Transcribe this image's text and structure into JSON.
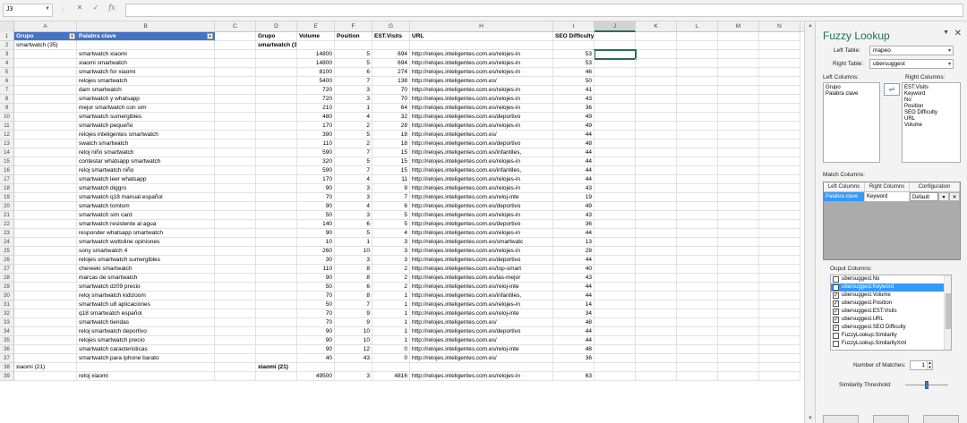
{
  "formula_bar": {
    "name_box": "J3",
    "fx_label": "fx",
    "formula": ""
  },
  "columns": [
    "A",
    "B",
    "C",
    "D",
    "E",
    "F",
    "G",
    "H",
    "I",
    "J",
    "K",
    "L",
    "M",
    "N"
  ],
  "selected_column": "J",
  "rows": [
    {
      "n": "1",
      "a": "Grupo",
      "b": "Palabra clave",
      "d": "Grupo",
      "e": "Volume",
      "f": "Position",
      "g": "EST.Visits",
      "h": "URL",
      "i": "SEO Difficulty"
    },
    {
      "n": "2",
      "a": "smartwatch (35)",
      "b": "",
      "d": "smartwatch (35)",
      "e": "",
      "f": "",
      "g": "",
      "h": "",
      "i": ""
    },
    {
      "n": "3",
      "a": "",
      "b": "smartwatch xiaomi",
      "d": "",
      "e": "14800",
      "f": "5",
      "g": "694",
      "h": "http://relojes.inteligentes.com.es/relojes-in",
      "i": "53"
    },
    {
      "n": "4",
      "a": "",
      "b": "xiaomi smartwatch",
      "d": "",
      "e": "14800",
      "f": "5",
      "g": "694",
      "h": "http://relojes.inteligentes.com.es/relojes-in",
      "i": "53"
    },
    {
      "n": "5",
      "a": "",
      "b": "smartwatch for xiaomi",
      "d": "",
      "e": "8100",
      "f": "6",
      "g": "274",
      "h": "http://relojes.inteligentes.com.es/relojes-in",
      "i": "46"
    },
    {
      "n": "6",
      "a": "",
      "b": "relojes smartwatch",
      "d": "",
      "e": "5400",
      "f": "7",
      "g": "138",
      "h": "http://relojes.inteligentes.com.es/",
      "i": "50"
    },
    {
      "n": "7",
      "a": "",
      "b": "dam smartwatch",
      "d": "",
      "e": "720",
      "f": "3",
      "g": "70",
      "h": "http://relojes.inteligentes.com.es/relojes-in",
      "i": "41"
    },
    {
      "n": "8",
      "a": "",
      "b": "smartwatch y whatsapp",
      "d": "",
      "e": "720",
      "f": "3",
      "g": "70",
      "h": "http://relojes.inteligentes.com.es/relojes-in",
      "i": "43"
    },
    {
      "n": "9",
      "a": "",
      "b": "mejor smartwatch con sim",
      "d": "",
      "e": "210",
      "f": "1",
      "g": "64",
      "h": "http://relojes.inteligentes.com.es/relojes-in",
      "i": "36"
    },
    {
      "n": "10",
      "a": "",
      "b": "smartwatch sumergibles",
      "d": "",
      "e": "480",
      "f": "4",
      "g": "32",
      "h": "http://relojes.inteligentes.com.es/deportivo",
      "i": "49"
    },
    {
      "n": "11",
      "a": "",
      "b": "smartwatch pequeño",
      "d": "",
      "e": "170",
      "f": "2",
      "g": "28",
      "h": "http://relojes.inteligentes.com.es/relojes-in",
      "i": "49"
    },
    {
      "n": "12",
      "a": "",
      "b": "relojes inteligentes smartwatch",
      "d": "",
      "e": "390",
      "f": "5",
      "g": "18",
      "h": "http://relojes.inteligentes.com.es/",
      "i": "44"
    },
    {
      "n": "13",
      "a": "",
      "b": "swatch smartwatch",
      "d": "",
      "e": "110",
      "f": "2",
      "g": "18",
      "h": "http://relojes.inteligentes.com.es/deportivo",
      "i": "48"
    },
    {
      "n": "14",
      "a": "",
      "b": "reloj niño smartwatch",
      "d": "",
      "e": "590",
      "f": "7",
      "g": "15",
      "h": "http://relojes.inteligentes.com.es/infantiles,",
      "i": "44"
    },
    {
      "n": "15",
      "a": "",
      "b": "contestar whatsapp smartwatch",
      "d": "",
      "e": "320",
      "f": "5",
      "g": "15",
      "h": "http://relojes.inteligentes.com.es/relojes-in",
      "i": "44"
    },
    {
      "n": "16",
      "a": "",
      "b": "reloj smartwatch niño",
      "d": "",
      "e": "590",
      "f": "7",
      "g": "15",
      "h": "http://relojes.inteligentes.com.es/infantiles,",
      "i": "44"
    },
    {
      "n": "17",
      "a": "",
      "b": "smartwatch leer whatsapp",
      "d": "",
      "e": "170",
      "f": "4",
      "g": "11",
      "h": "http://relojes.inteligentes.com.es/relojes-in",
      "i": "44"
    },
    {
      "n": "18",
      "a": "",
      "b": "smartwatch diggro",
      "d": "",
      "e": "90",
      "f": "3",
      "g": "9",
      "h": "http://relojes.inteligentes.com.es/relojes-in",
      "i": "43"
    },
    {
      "n": "19",
      "a": "",
      "b": "smartwatch q18 manual español",
      "d": "",
      "e": "70",
      "f": "3",
      "g": "7",
      "h": "http://relojes.inteligentes.com.es/reloj-inte",
      "i": "19"
    },
    {
      "n": "20",
      "a": "",
      "b": "smartwatch tomtom",
      "d": "",
      "e": "90",
      "f": "4",
      "g": "6",
      "h": "http://relojes.inteligentes.com.es/deportivo",
      "i": "49"
    },
    {
      "n": "21",
      "a": "",
      "b": "smartwatch sim card",
      "d": "",
      "e": "50",
      "f": "3",
      "g": "5",
      "h": "http://relojes.inteligentes.com.es/relojes-in",
      "i": "43"
    },
    {
      "n": "22",
      "a": "",
      "b": "smartwatch resistente al agua",
      "d": "",
      "e": "140",
      "f": "6",
      "g": "5",
      "h": "http://relojes.inteligentes.com.es/deportivo",
      "i": "36"
    },
    {
      "n": "23",
      "a": "",
      "b": "responder whatsapp smartwatch",
      "d": "",
      "e": "90",
      "f": "5",
      "g": "4",
      "h": "http://relojes.inteligentes.com.es/relojes-in",
      "i": "44"
    },
    {
      "n": "24",
      "a": "",
      "b": "smartwatch wottoline opiniones",
      "d": "",
      "e": "10",
      "f": "1",
      "g": "3",
      "h": "http://relojes.inteligentes.com.es/smartwatc",
      "i": "13"
    },
    {
      "n": "25",
      "a": "",
      "b": "sony smartwatch 4",
      "d": "",
      "e": "260",
      "f": "10",
      "g": "3",
      "h": "http://relojes.inteligentes.com.es/relojes-in",
      "i": "28"
    },
    {
      "n": "26",
      "a": "",
      "b": "relojes smartwatch sumergibles",
      "d": "",
      "e": "30",
      "f": "3",
      "g": "3",
      "h": "http://relojes.inteligentes.com.es/deportivo",
      "i": "44"
    },
    {
      "n": "27",
      "a": "",
      "b": "chereeki smartwatch",
      "d": "",
      "e": "110",
      "f": "8",
      "g": "2",
      "h": "http://relojes.inteligentes.com.es/top-smart",
      "i": "40"
    },
    {
      "n": "28",
      "a": "",
      "b": "marcas de smartwatch",
      "d": "",
      "e": "90",
      "f": "8",
      "g": "2",
      "h": "http://relojes.inteligentes.com.es/las-mejor",
      "i": "43"
    },
    {
      "n": "29",
      "a": "",
      "b": "smartwatch dz09 precio",
      "d": "",
      "e": "50",
      "f": "6",
      "g": "2",
      "h": "http://relojes.inteligentes.com.es/reloj-inte",
      "i": "44"
    },
    {
      "n": "30",
      "a": "",
      "b": "reloj smartwatch kidizoom",
      "d": "",
      "e": "70",
      "f": "8",
      "g": "1",
      "h": "http://relojes.inteligentes.com.es/infantiles,",
      "i": "44"
    },
    {
      "n": "31",
      "a": "",
      "b": "smartwatch u8 aplicaciones",
      "d": "",
      "e": "50",
      "f": "7",
      "g": "1",
      "h": "http://relojes.inteligentes.com.es/relojes-in",
      "i": "14"
    },
    {
      "n": "32",
      "a": "",
      "b": "q18 smartwatch español",
      "d": "",
      "e": "70",
      "f": "9",
      "g": "1",
      "h": "http://relojes.inteligentes.com.es/reloj-inte",
      "i": "34"
    },
    {
      "n": "33",
      "a": "",
      "b": "smartwatch tiendas",
      "d": "",
      "e": "70",
      "f": "9",
      "g": "1",
      "h": "http://relojes.inteligentes.com.es/",
      "i": "48"
    },
    {
      "n": "34",
      "a": "",
      "b": "reloj smartwatch deportivo",
      "d": "",
      "e": "90",
      "f": "10",
      "g": "1",
      "h": "http://relojes.inteligentes.com.es/deportivo",
      "i": "44"
    },
    {
      "n": "35",
      "a": "",
      "b": "relojes smartwatch precio",
      "d": "",
      "e": "90",
      "f": "10",
      "g": "1",
      "h": "http://relojes.inteligentes.com.es/",
      "i": "44"
    },
    {
      "n": "36",
      "a": "",
      "b": "smartwatch caracteristicas",
      "d": "",
      "e": "90",
      "f": "12",
      "g": "0",
      "h": "http://relojes.inteligentes.com.es/reloj-inte",
      "i": "48"
    },
    {
      "n": "37",
      "a": "",
      "b": "smartwatch para iphone barato",
      "d": "",
      "e": "40",
      "f": "43",
      "g": "0",
      "h": "http://relojes.inteligentes.com.es/",
      "i": "36"
    },
    {
      "n": "38",
      "a": "xiaomi (21)",
      "b": "",
      "d": "xiaomi (21)",
      "e": "",
      "f": "",
      "g": "",
      "h": "",
      "i": ""
    },
    {
      "n": "39",
      "a": "",
      "b": "reloj xiaomi",
      "d": "",
      "e": "49500",
      "f": "3",
      "g": "4816",
      "h": "http://relojes.inteligentes.com.es/relojes-in",
      "i": "63"
    }
  ],
  "panel": {
    "title": "Fuzzy Lookup",
    "left_table_label": "Left Table:",
    "left_table_value": "mapeo",
    "right_table_label": "Right Table:",
    "right_table_value": "ubersuggest",
    "left_columns_label": "Left Columns:",
    "right_columns_label": "Right Columns:",
    "left_columns": [
      "Grupo",
      "Palabra clave"
    ],
    "right_columns": [
      "EST.Visits",
      "Keyword",
      "No",
      "Position",
      "SEO Difficulty",
      "URL",
      "Volume"
    ],
    "match_columns_label": "Match Columns:",
    "match_headers": [
      "Left Columns",
      "Right Columns",
      "Configuration"
    ],
    "match_row": {
      "left": "Palabra clave",
      "right": "Keyword",
      "config": "Default"
    },
    "output_columns_label": "Ouput Columns:",
    "output_columns": [
      {
        "label": "ubersuggest.No",
        "checked": false,
        "selected": false
      },
      {
        "label": "ubersuggest.Keyword",
        "checked": false,
        "selected": true
      },
      {
        "label": "ubersuggest.Volume",
        "checked": true,
        "selected": false
      },
      {
        "label": "ubersuggest.Position",
        "checked": true,
        "selected": false
      },
      {
        "label": "ubersuggest.EST.Visits",
        "checked": true,
        "selected": false
      },
      {
        "label": "ubersuggest.URL",
        "checked": true,
        "selected": false
      },
      {
        "label": "ubersuggest.SEO Difficulty",
        "checked": true,
        "selected": false
      },
      {
        "label": "FuzzyLookup.Similarity",
        "checked": false,
        "selected": false
      },
      {
        "label": "FuzzyLookup.SimilarityXml",
        "checked": false,
        "selected": false
      }
    ],
    "matches_label": "Number of Matches:",
    "matches_value": "1",
    "threshold_label": "Similarity Threshold:",
    "threshold_value": 0.5
  }
}
